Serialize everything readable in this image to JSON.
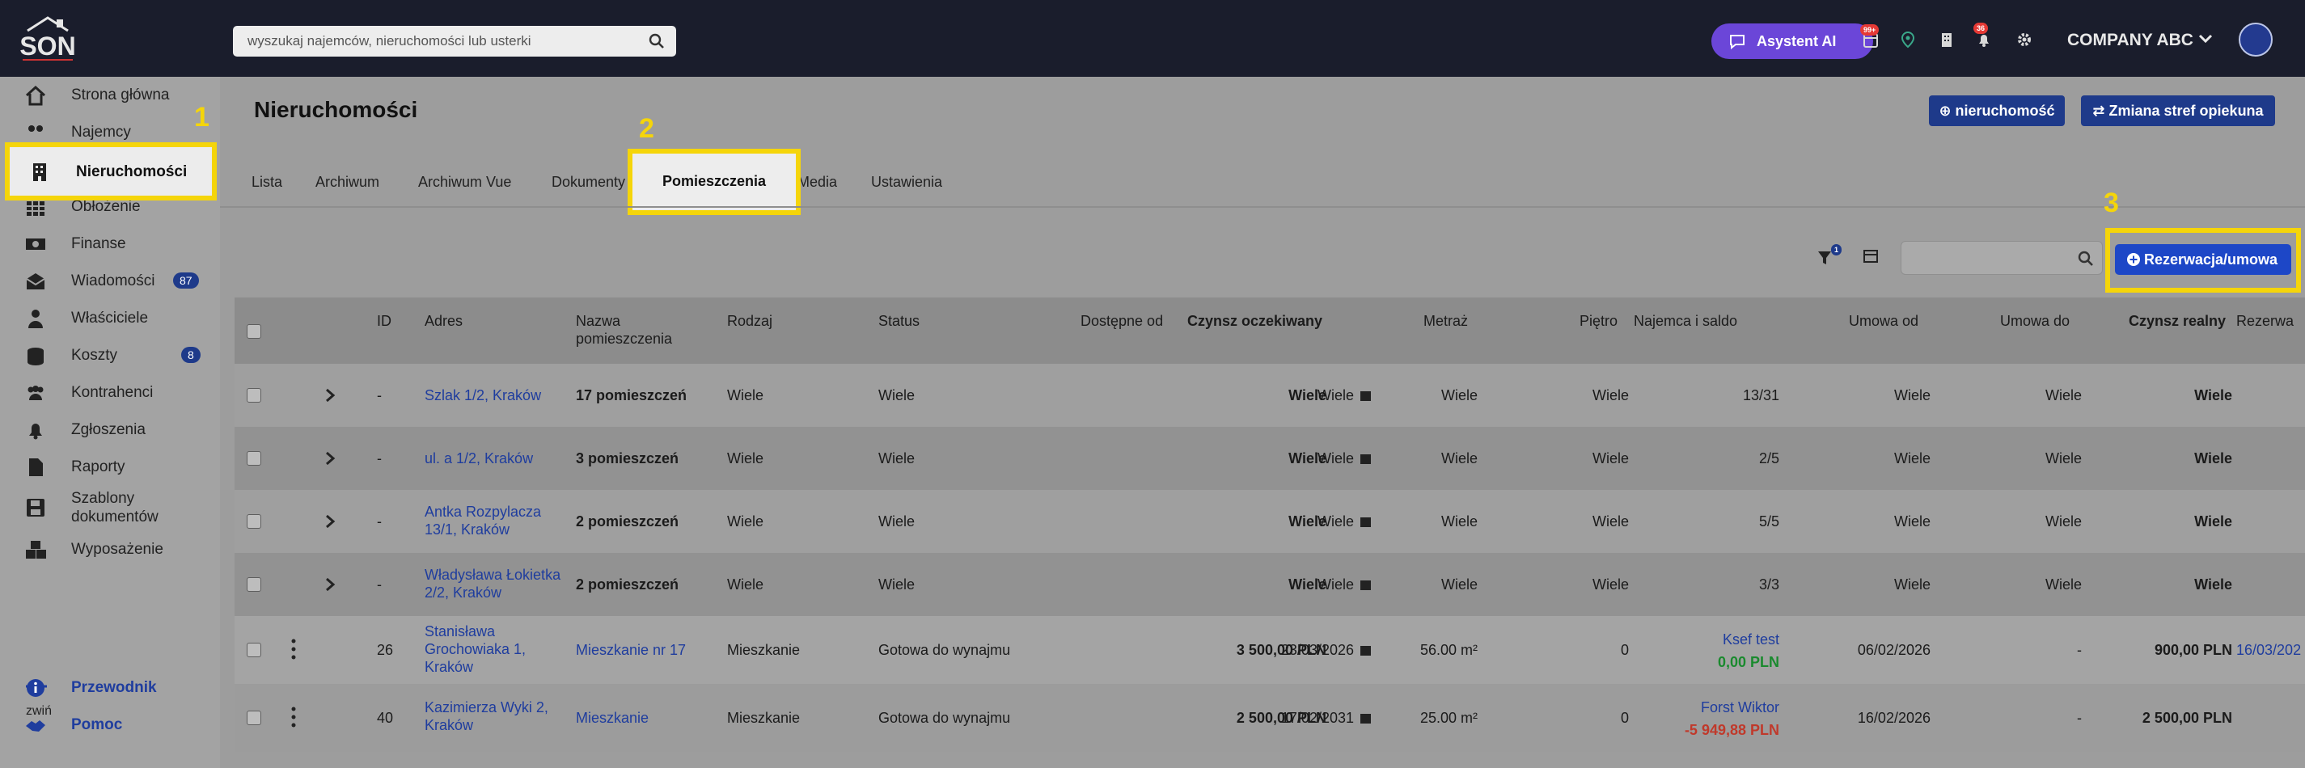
{
  "header": {
    "logo_text": "SON",
    "search_placeholder": "wyszukaj najemców, nieruchomości lub usterki",
    "ai_button": "Asystent AI",
    "notifications_badge": "99+",
    "bell_badge": "36",
    "company": "COMPANY ABC"
  },
  "sidebar": {
    "items": [
      {
        "label": "Strona główna"
      },
      {
        "label": "Najemcy"
      },
      {
        "label": "Nieruchomości"
      },
      {
        "label": "Obłożenie"
      },
      {
        "label": "Finanse"
      },
      {
        "label": "Wiadomości",
        "count": "87"
      },
      {
        "label": "Właściciele"
      },
      {
        "label": "Koszty",
        "count": "8"
      },
      {
        "label": "Kontrahenci"
      },
      {
        "label": "Zgłoszenia"
      },
      {
        "label": "Raporty"
      },
      {
        "label": "Szablony dokumentów"
      },
      {
        "label": "Wyposażenie"
      }
    ],
    "collapse_label": "zwiń",
    "guide": "Przewodnik",
    "help": "Pomoc"
  },
  "callouts": {
    "one": "1",
    "two": "2",
    "three": "3"
  },
  "page": {
    "title": "Nieruchomości",
    "add_button": "nieruchomość",
    "zones_button": "Zmiana stref opiekuna"
  },
  "tabs": [
    "Lista",
    "Archiwum",
    "Archiwum Vue",
    "Dokumenty",
    "Pomieszczenia",
    "Media",
    "Ustawienia"
  ],
  "active_tab": "Pomieszczenia",
  "toolbar": {
    "filter_badge": "1",
    "reservation_button": "Rezerwacja/umowa"
  },
  "table": {
    "columns": [
      "ID",
      "Adres",
      "Nazwa pomieszczenia",
      "Rodzaj",
      "Status",
      "Dostępne od",
      "Czynsz oczekiwany",
      "Metraż",
      "Piętro",
      "Najemca i saldo",
      "Umowa od",
      "Umowa do",
      "Czynsz realny",
      "Rezerwa"
    ],
    "rows": [
      {
        "id": "-",
        "address": "Szlak 1/2, Kraków",
        "name": "17 pomieszczeń",
        "kind": "Wiele",
        "status": "Wiele",
        "available": "Wiele",
        "rent_expected": "Wiele",
        "area": "Wiele",
        "floor": "Wiele",
        "tenant": "13/31",
        "balance": "",
        "from": "Wiele",
        "to": "Wiele",
        "rent_real": "Wiele",
        "reserve": ""
      },
      {
        "id": "-",
        "address": "ul. a 1/2, Kraków",
        "name": "3 pomieszczeń",
        "kind": "Wiele",
        "status": "Wiele",
        "available": "Wiele",
        "rent_expected": "Wiele",
        "area": "Wiele",
        "floor": "Wiele",
        "tenant": "2/5",
        "balance": "",
        "from": "Wiele",
        "to": "Wiele",
        "rent_real": "Wiele",
        "reserve": ""
      },
      {
        "id": "-",
        "address": "Antka Rozpylacza 13/1, Kraków",
        "name": "2 pomieszczeń",
        "kind": "Wiele",
        "status": "Wiele",
        "available": "Wiele",
        "rent_expected": "Wiele",
        "area": "Wiele",
        "floor": "Wiele",
        "tenant": "5/5",
        "balance": "",
        "from": "Wiele",
        "to": "Wiele",
        "rent_real": "Wiele",
        "reserve": ""
      },
      {
        "id": "-",
        "address": "Władysława Łokietka 2/2, Kraków",
        "name": "2 pomieszczeń",
        "kind": "Wiele",
        "status": "Wiele",
        "available": "Wiele",
        "rent_expected": "Wiele",
        "area": "Wiele",
        "floor": "Wiele",
        "tenant": "3/3",
        "balance": "",
        "from": "Wiele",
        "to": "Wiele",
        "rent_real": "Wiele",
        "reserve": ""
      },
      {
        "id": "26",
        "address": "Stanisława Grochowiaka 1, Kraków",
        "name": "Mieszkanie nr 17",
        "kind": "Mieszkanie",
        "status": "Gotowa do wynajmu",
        "available": "23/03/2026",
        "rent_expected": "3 500,00 PLN",
        "area": "56.00 m²",
        "floor": "0",
        "tenant": "Ksef test",
        "balance": "0,00 PLN",
        "from": "06/02/2026",
        "to": "-",
        "rent_real": "900,00 PLN",
        "reserve": "16/03/202"
      },
      {
        "id": "40",
        "address": "Kazimierza Wyki 2, Kraków",
        "name": "Mieszkanie",
        "kind": "Mieszkanie",
        "status": "Gotowa do wynajmu",
        "available": "17/02/2031",
        "rent_expected": "2 500,00 PLN",
        "area": "25.00 m²",
        "floor": "0",
        "tenant": "Forst Wiktor",
        "balance": "-5 949,88 PLN",
        "from": "16/02/2026",
        "to": "-",
        "rent_real": "2 500,00 PLN",
        "reserve": ""
      }
    ]
  },
  "colors": {
    "accent": "#1e3a8a",
    "highlight": "#f5d50a",
    "ai": "#6b46d8",
    "positive": "#1a8a2e",
    "negative": "#c0392b"
  }
}
